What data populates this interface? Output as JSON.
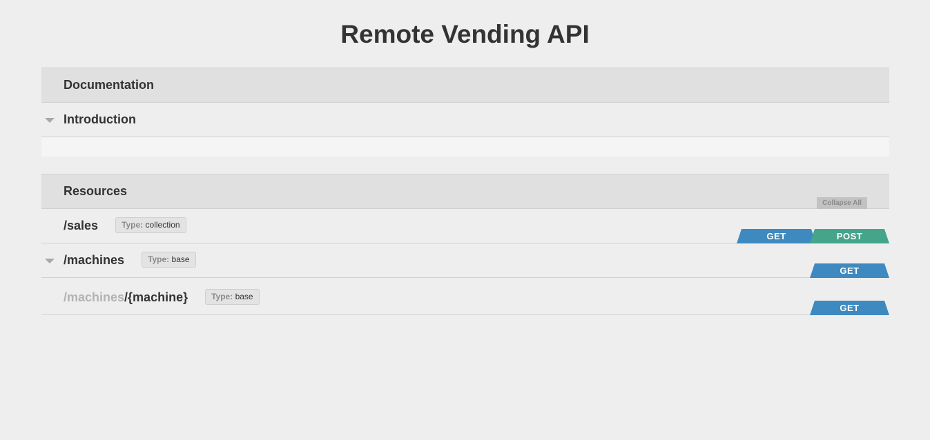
{
  "page": {
    "title": "Remote Vending API"
  },
  "documentation": {
    "header": "Documentation",
    "sections": [
      {
        "title": "Introduction",
        "expanded": true,
        "body": ""
      }
    ]
  },
  "resources": {
    "header": "Resources",
    "collapse_all_label": "Collapse All",
    "items": [
      {
        "path_prefix": "",
        "path": "/sales",
        "type_key": "Type:",
        "type_value": "collection",
        "expandable": false,
        "methods": [
          "GET",
          "POST"
        ]
      },
      {
        "path_prefix": "",
        "path": "/machines",
        "type_key": "Type:",
        "type_value": "base",
        "expandable": true,
        "methods": [
          "GET"
        ]
      },
      {
        "path_prefix": "/machines",
        "path": "/{machine}",
        "type_key": "Type:",
        "type_value": "base",
        "expandable": false,
        "methods": [
          "GET"
        ]
      }
    ]
  },
  "colors": {
    "get": "#3e89bf",
    "post": "#44a58b",
    "background": "#eeeeee",
    "header_band": "#e0e0e0"
  },
  "icons": {
    "expand": "caret-down-icon"
  }
}
